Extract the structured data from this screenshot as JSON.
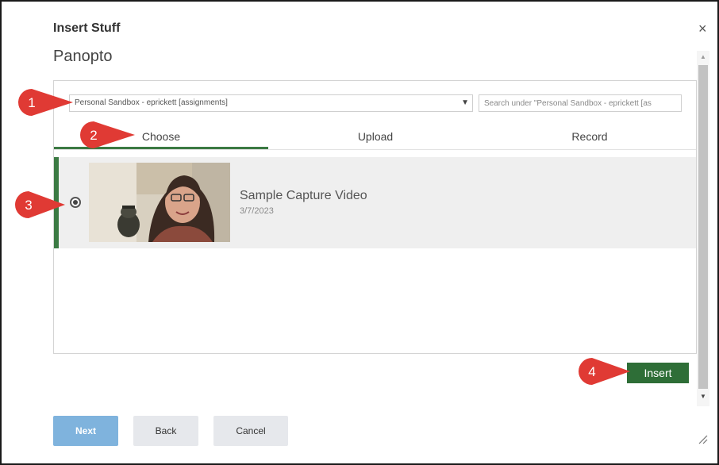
{
  "dialog": {
    "title": "Insert Stuff",
    "subtitle": "Panopto",
    "close_symbol": "×"
  },
  "folder_select": {
    "value": "Personal Sandbox - eprickett [assignments]",
    "caret": "▼"
  },
  "search": {
    "placeholder": "Search under \"Personal Sandbox - eprickett [as"
  },
  "tabs": [
    {
      "label": "Choose",
      "active": true
    },
    {
      "label": "Upload",
      "active": false
    },
    {
      "label": "Record",
      "active": false
    }
  ],
  "video": {
    "title": "Sample Capture Video",
    "date": "3/7/2023",
    "selected": true
  },
  "scrollbar": {
    "up": "▲",
    "down": "▼"
  },
  "insert_label": "Insert",
  "footer": {
    "next_label": "Next",
    "back_label": "Back",
    "cancel_label": "Cancel"
  },
  "callouts": [
    "1",
    "2",
    "3",
    "4"
  ],
  "colors": {
    "accent_green": "#2e6e37",
    "callout_red": "#e03a34",
    "next_blue": "#7fb3dd"
  }
}
